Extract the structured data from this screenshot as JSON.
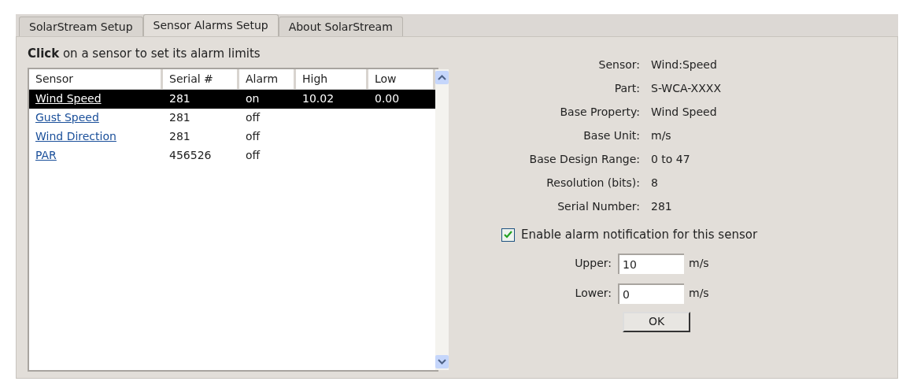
{
  "tabs": [
    {
      "label": "SolarStream Setup",
      "selected": false
    },
    {
      "label": "Sensor Alarms Setup",
      "selected": true
    },
    {
      "label": "About SolarStream",
      "selected": false
    }
  ],
  "instruction": "**Click** on a sensor to set its alarm limits",
  "table": {
    "columns": [
      "Sensor",
      "Serial #",
      "Alarm",
      "High",
      "Low"
    ],
    "rows": [
      {
        "cells": [
          "Wind Speed",
          "281",
          "on",
          "10.02",
          "0.00"
        ],
        "selected": true
      },
      {
        "cells": [
          "Gust Speed",
          "281",
          "off",
          "",
          ""
        ],
        "selected": false
      },
      {
        "cells": [
          "Wind Direction",
          "281",
          "off",
          "",
          ""
        ],
        "selected": false
      },
      {
        "cells": [
          "PAR",
          "456526",
          "off",
          "",
          ""
        ],
        "selected": false
      }
    ]
  },
  "details": [
    {
      "label": "Sensor:",
      "value": "Wind:Speed"
    },
    {
      "label": "Part:",
      "value": "S-WCA-XXXX"
    },
    {
      "label": "Base Property:",
      "value": "Wind Speed"
    },
    {
      "label": "Base Unit:",
      "value": "m/s"
    },
    {
      "label": "Base Design Range:",
      "value": "0 to 47"
    },
    {
      "label": "Resolution (bits):",
      "value": "8"
    },
    {
      "label": "Serial Number:",
      "value": "281"
    }
  ],
  "alarm_checkbox": {
    "label": "Enable alarm notification for this sensor",
    "checked": true
  },
  "limits": [
    {
      "label": "Upper:",
      "value": "10",
      "unit": "m/s"
    },
    {
      "label": "Lower:",
      "value": "0",
      "unit": "m/s"
    }
  ],
  "ok_button": "OK"
}
